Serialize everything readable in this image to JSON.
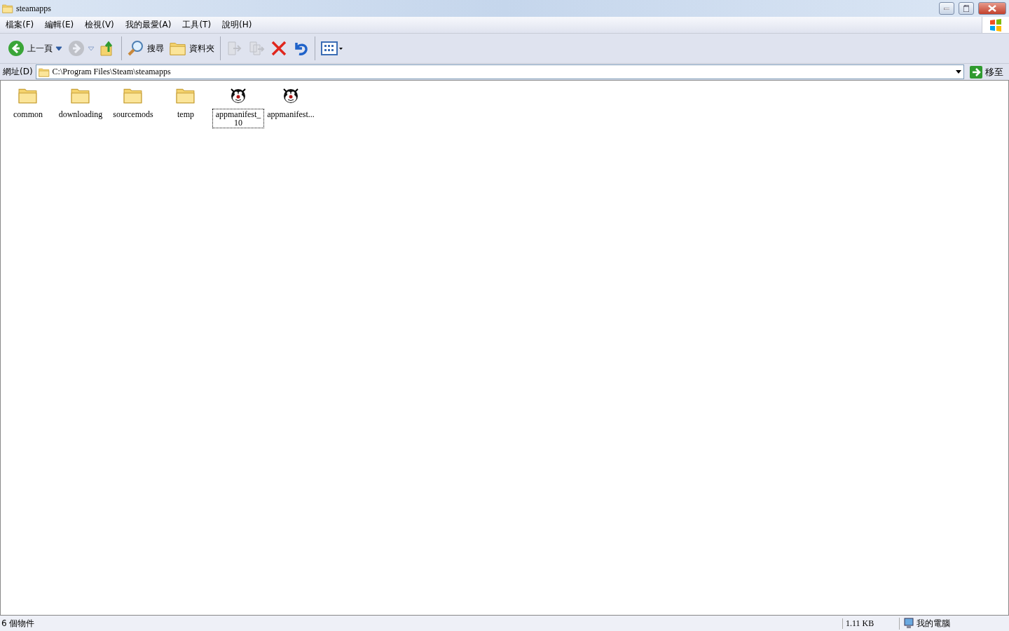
{
  "window": {
    "title": "steamapps"
  },
  "menu": [
    "檔案(F)",
    "編輯(E)",
    "檢視(V)",
    "我的最愛(A)",
    "工具(T)",
    "說明(H)"
  ],
  "toolbar": [
    {
      "kind": "back",
      "label": "上一頁",
      "disabled": false
    },
    {
      "kind": "forward",
      "disabled": true
    },
    {
      "kind": "up",
      "disabled": false
    },
    {
      "kind": "search",
      "label": "搜尋",
      "disabled": false
    },
    {
      "kind": "folders",
      "label": "資料夾",
      "disabled": false
    },
    {
      "kind": "move",
      "disabled": true
    },
    {
      "kind": "copy",
      "disabled": true
    },
    {
      "kind": "delete",
      "disabled": false
    },
    {
      "kind": "undo",
      "disabled": false
    },
    {
      "kind": "views",
      "disabled": false
    }
  ],
  "address": {
    "label": "網址(D)",
    "value": "C:\\Program Files\\Steam\\steamapps",
    "go": "移至"
  },
  "files": [
    {
      "name": "common",
      "kind": "folder",
      "selected": false
    },
    {
      "name": "downloading",
      "kind": "folder",
      "selected": false
    },
    {
      "name": "sourcemods",
      "kind": "folder",
      "selected": false
    },
    {
      "name": "temp",
      "kind": "folder",
      "selected": false
    },
    {
      "name": "appmanifest_10",
      "kind": "manifest",
      "selected": true
    },
    {
      "name": "appmanifest...",
      "kind": "manifest",
      "selected": false
    }
  ],
  "status_bar": {
    "objects": "6 個物件",
    "size": "1.11 KB",
    "zone": "我的電腦"
  }
}
